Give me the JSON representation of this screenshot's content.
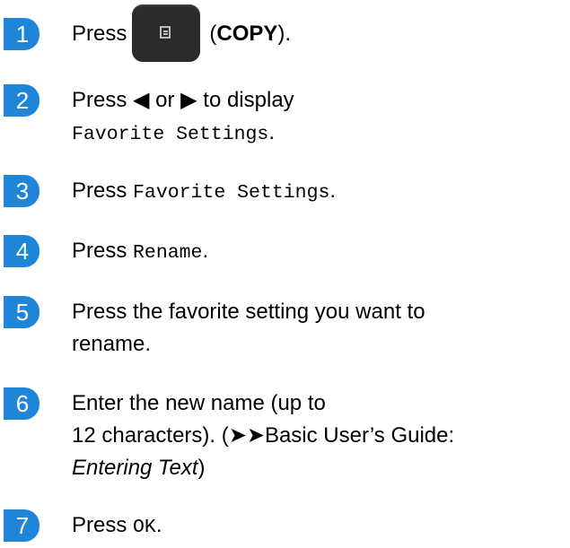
{
  "steps": [
    {
      "number": "1",
      "press": "Press",
      "key_icon": "copy-key-icon",
      "open_paren": "(",
      "key_label": "COPY",
      "close_paren": ")."
    },
    {
      "number": "2",
      "line1": "Press ◀ or ▶ to display",
      "mono": "Favorite Settings",
      "suffix": "."
    },
    {
      "number": "3",
      "press": "Press",
      "mono": "Favorite Settings",
      "suffix": "."
    },
    {
      "number": "4",
      "press": "Press",
      "mono": "Rename",
      "suffix": "."
    },
    {
      "number": "5",
      "line1": "Press the favorite setting you want to",
      "line2": "rename."
    },
    {
      "number": "6",
      "line1": "Enter the new name (up to",
      "line2a": "12 characters). (",
      "arrows": "➤➤",
      "line2b": "Basic User’s Guide:",
      "italic": "Entering Text",
      "line3_suffix": ")"
    },
    {
      "number": "7",
      "press": "Press",
      "mono": "OK",
      "suffix": "."
    }
  ],
  "colors": {
    "badge": "#1f85d8",
    "key": "#2b2b2b"
  }
}
